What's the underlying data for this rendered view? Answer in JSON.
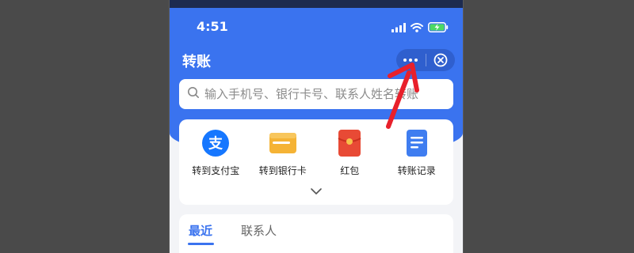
{
  "status_bar": {
    "time": "4:51"
  },
  "header": {
    "title": "转账"
  },
  "capsule": {
    "more_icon": "more-dots-icon",
    "close_icon": "close-circle-icon"
  },
  "search": {
    "placeholder": "输入手机号、银行卡号、联系人姓名转账",
    "icon": "search-icon"
  },
  "actions": [
    {
      "label": "转到支付宝",
      "icon": "alipay-icon",
      "color": "#1677ff"
    },
    {
      "label": "转到银行卡",
      "icon": "bank-card-icon",
      "color": "#f5b335"
    },
    {
      "label": "红包",
      "icon": "red-envelope-icon",
      "color": "#e84a35"
    },
    {
      "label": "转账记录",
      "icon": "record-icon",
      "color": "#3f7df0"
    }
  ],
  "expand_icon": "chevron-down-icon",
  "tabs": [
    {
      "label": "最近",
      "active": true
    },
    {
      "label": "联系人",
      "active": false
    }
  ],
  "annotation": {
    "icon": "red-arrow-icon",
    "color": "#e8202b"
  },
  "colors": {
    "brand_blue": "#3a73ef",
    "background": "#4a4a4a"
  }
}
